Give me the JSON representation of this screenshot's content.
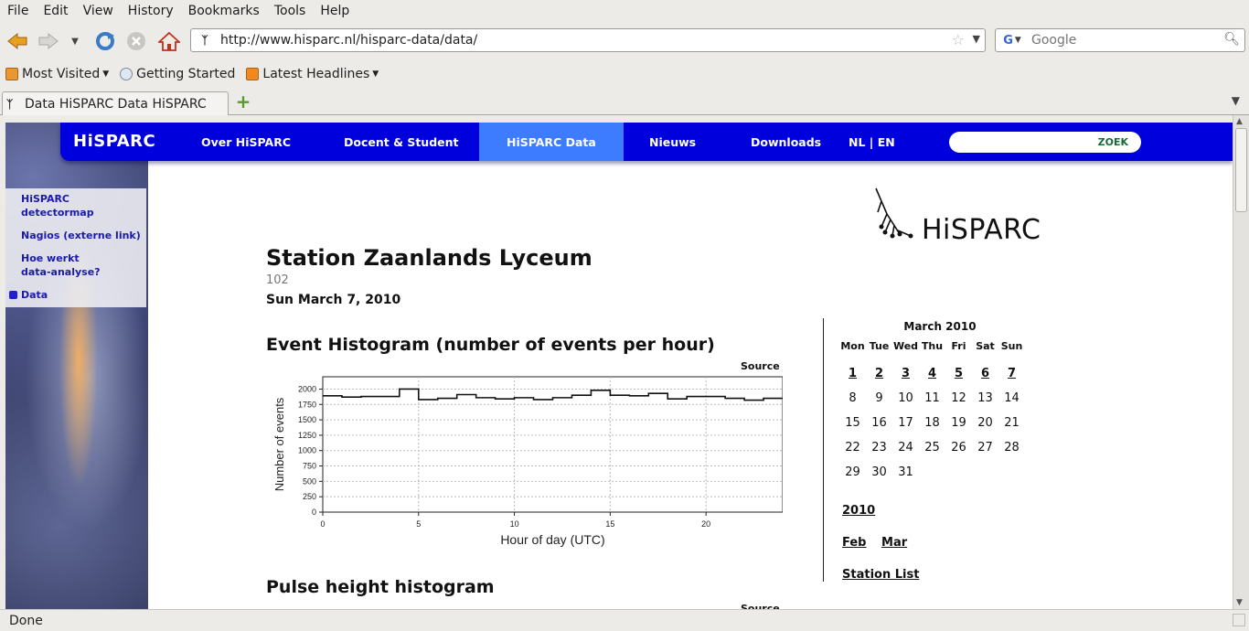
{
  "menu": [
    "File",
    "Edit",
    "View",
    "History",
    "Bookmarks",
    "Tools",
    "Help"
  ],
  "address": {
    "url": "http://www.hisparc.nl/hisparc-data/data/"
  },
  "search": {
    "placeholder": "Google"
  },
  "bookmarks": [
    "Most Visited",
    "Getting Started",
    "Latest Headlines"
  ],
  "tab": {
    "title": "Data HiSPARC Data HiSPARC"
  },
  "status": {
    "text": "Done"
  },
  "site": {
    "brand": "HiSPARC",
    "nav": [
      "Over HiSPARC",
      "Docent & Student",
      "HiSPARC Data",
      "Nieuws",
      "Downloads",
      "NL | EN"
    ],
    "search_button": "ZOEK",
    "logo_text": "HiSPARC",
    "sidenav": [
      "HiSPARC detectormap",
      "Nagios (externe link)",
      "Hoe werkt data-analyse?",
      "Data"
    ]
  },
  "page": {
    "title": "Station Zaanlands Lyceum",
    "station_number": "102",
    "date": "Sun March 7, 2010",
    "histogram_title": "Event Histogram (number of events per hour)",
    "source_label": "Source",
    "pulse_title": "Pulse height histogram"
  },
  "calendar": {
    "month": "March 2010",
    "days": [
      "Mon",
      "Tue",
      "Wed",
      "Thu",
      "Fri",
      "Sat",
      "Sun"
    ],
    "weeks": [
      [
        "1",
        "2",
        "3",
        "4",
        "5",
        "6",
        "7"
      ],
      [
        "8",
        "9",
        "10",
        "11",
        "12",
        "13",
        "14"
      ],
      [
        "15",
        "16",
        "17",
        "18",
        "19",
        "20",
        "21"
      ],
      [
        "22",
        "23",
        "24",
        "25",
        "26",
        "27",
        "28"
      ],
      [
        "29",
        "30",
        "31",
        "",
        "",
        "",
        ""
      ]
    ],
    "linked": [
      "1",
      "2",
      "3",
      "4",
      "5",
      "6",
      "7"
    ],
    "year": "2010",
    "months": [
      "Feb",
      "Mar"
    ],
    "station_list": "Station List"
  },
  "chart_data": {
    "type": "line",
    "xlabel": "Hour of day (UTC)",
    "ylabel": "Number of events",
    "xlim": [
      0,
      24
    ],
    "ylim": [
      0,
      2200
    ],
    "xticks": [
      0,
      5,
      10,
      15,
      20
    ],
    "yticks": [
      0,
      250,
      500,
      750,
      1000,
      1250,
      1500,
      1750,
      2000
    ],
    "grid": true,
    "step": true,
    "x": [
      0,
      1,
      2,
      3,
      4,
      5,
      6,
      7,
      8,
      9,
      10,
      11,
      12,
      13,
      14,
      15,
      16,
      17,
      18,
      19,
      20,
      21,
      22,
      23
    ],
    "values": [
      1890,
      1870,
      1880,
      1880,
      2000,
      1830,
      1850,
      1910,
      1860,
      1840,
      1860,
      1830,
      1860,
      1900,
      1980,
      1900,
      1890,
      1930,
      1840,
      1880,
      1880,
      1850,
      1820,
      1850
    ]
  }
}
